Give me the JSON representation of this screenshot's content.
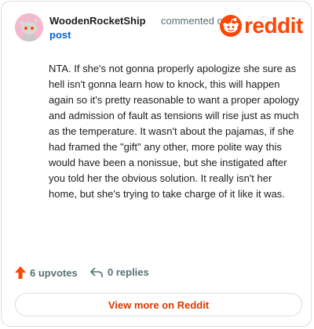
{
  "comment": {
    "author": "WoodenRocketShip",
    "action_text": "commented on",
    "post_link": "post",
    "body": "NTA. If she's not gonna properly apologize she sure as hell isn't gonna learn how to knock, this will happen again so it's pretty reasonable to want a proper apology and admission of fault as tensions will rise just as much as the temperature. It wasn't about the pajamas, if she had framed the \"gift\" any other, more polite way this would have been a nonissue, but she instigated after you told her the obvious solution. It really isn't her home, but she's trying to take charge of it like it was."
  },
  "brand": {
    "name": "reddit",
    "color": "#ff4500"
  },
  "footer": {
    "upvotes": "6 upvotes",
    "replies": "0 replies",
    "view_more": "View more on Reddit"
  },
  "icons": {
    "avatar": "snoo-avatar",
    "logo": "reddit-snoo-icon",
    "upvote": "upvote-arrow-icon",
    "reply": "reply-arrow-icon"
  }
}
